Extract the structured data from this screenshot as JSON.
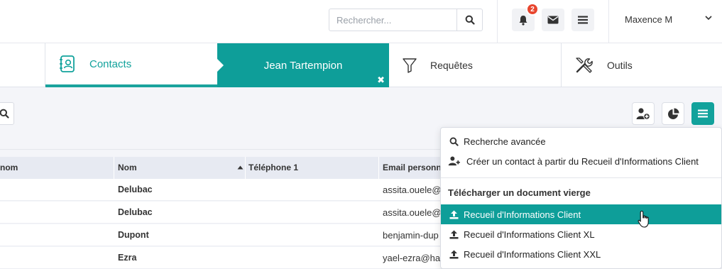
{
  "header": {
    "search_placeholder": "Rechercher...",
    "notification_count": "2",
    "user_name": "Maxence M"
  },
  "tabs": [
    {
      "label": "Contacts"
    },
    {
      "label": "Jean Tartempion",
      "close": "✖"
    },
    {
      "label": "Requêtes"
    },
    {
      "label": "Outils"
    }
  ],
  "table": {
    "columns": [
      "nom",
      "Nom",
      "Téléphone 1",
      "Email personn"
    ],
    "rows": [
      {
        "nom": "Delubac",
        "email": "assita.ouele@"
      },
      {
        "nom": "Delubac",
        "email": "assita.ouele@"
      },
      {
        "nom": "Dupont",
        "email": "benjamin-dup"
      },
      {
        "nom": "Ezra",
        "email": "yael-ezra@han"
      }
    ]
  },
  "menu": {
    "advanced_search": "Recherche avancée",
    "create_contact": "Créer un contact à partir du Recueil d'Informations Client",
    "download_header": "Télécharger un document vierge",
    "downloads": [
      "Recueil d'Informations Client",
      "Recueil d'Informations Client XL",
      "Recueil d'Informations Client XXL"
    ]
  },
  "colors": {
    "accent": "#0e9e99",
    "badge": "#e8462f"
  }
}
